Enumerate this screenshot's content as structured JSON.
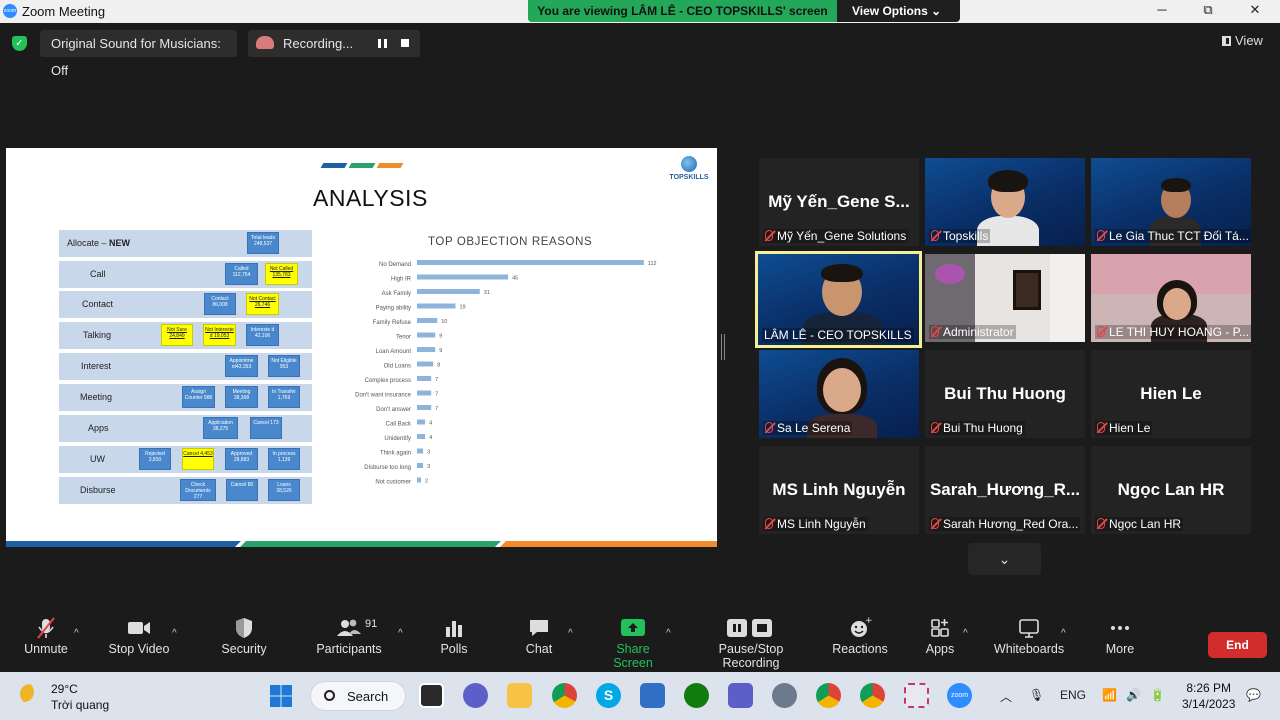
{
  "titlebar": {
    "title": "Zoom Meeting",
    "minimize": "─",
    "maximize": "⧉",
    "close": "✕"
  },
  "banner": {
    "text": "You are viewing LÂM LÊ - CEO TOPSKILLS' screen",
    "view_options": "View Options ⌄"
  },
  "topbar": {
    "original_sound": "Original Sound for Musicians: Off",
    "recording": "Recording...",
    "view": "View"
  },
  "slide": {
    "title": "ANALYSIS",
    "logo_text": "TOPSKILLS",
    "funnel_rows": [
      {
        "label": "Allocate – NEW",
        "bold": "NEW"
      },
      {
        "label": "Call"
      },
      {
        "label": "Contact"
      },
      {
        "label": "Talking"
      },
      {
        "label": "Interest"
      },
      {
        "label": "Meeting"
      },
      {
        "label": "Apps"
      },
      {
        "label": "UW"
      },
      {
        "label": "Disburse"
      }
    ],
    "funnel_boxes": {
      "total": "Total leads 248,537",
      "called": "Called 112,754",
      "not_called": "Not Called 135,783",
      "contact": "Contact 86,008",
      "not_contact": "Not Contact 26,746",
      "not_sure": "Not Sure 24,849",
      "not_interested": "Not Intereste d 19,053",
      "interested": "Intereste d 42,106",
      "appointment": "Appointme nt43,353",
      "not_eligible": "Not Eligible 953",
      "assign_counter": "Assign Counter 986",
      "meeting": "Meeting 38,368",
      "in_transfer": "In Transfer 1,769",
      "application": "Application 38,275",
      "cancel_apps": "Cancel 173",
      "rejected": "Rejected 3,830",
      "cancel_uw": "Cancel 4,453",
      "approved": "Approved 28,883",
      "in_process": "In process 1,139",
      "check_documents": "Check Documents 277",
      "cancel_disb": "Cancel 80",
      "loans": "Loans 28,526"
    }
  },
  "chart_data": {
    "type": "bar",
    "orientation": "horizontal",
    "title": "TOP OBJECTION REASONS",
    "categories": [
      "No Demand",
      "High IR",
      "Ask Family",
      "Paying ability",
      "Family Refuse",
      "Tenor",
      "Loan Amount",
      "Old Loans",
      "Complex process",
      "Don't want insurance",
      "Don't answer",
      "Call Back",
      "Unidentify",
      "Think again",
      "Disburse too long",
      "Not customer"
    ],
    "values": [
      112,
      45,
      31,
      19,
      10,
      9,
      9,
      8,
      7,
      7,
      7,
      4,
      4,
      3,
      3,
      2
    ],
    "xticks": [
      0,
      20,
      40,
      60,
      80,
      100,
      120
    ],
    "xlim": [
      0,
      120
    ],
    "color": "#8fb4dc"
  },
  "tiles": [
    {
      "big": "Mỹ Yến_Gene S...",
      "name": "Mỹ Yến_Gene Solutions"
    },
    {
      "big": "",
      "name": "Topskills"
    },
    {
      "big": "",
      "name": "Le Gia Thuc TCT Đối Tá..."
    },
    {
      "big": "",
      "name": "LÂM LÊ - CEO TOPSKILLS"
    },
    {
      "big": "",
      "name": "Administrator"
    },
    {
      "big": "",
      "name": "LE THI HUY HOANG - P..."
    },
    {
      "big": "",
      "name": "Sa Le Serena"
    },
    {
      "big": "Bui Thu Huong",
      "name": "Bui Thu Huong"
    },
    {
      "big": "Hien Le",
      "name": "Hien Le"
    },
    {
      "big": "MS Linh Nguyễn",
      "name": "MS Linh Nguyễn"
    },
    {
      "big": "Sarah_Hương_R...",
      "name": "Sarah Hương_Red Ora..."
    },
    {
      "big": "Ngọc Lan HR",
      "name": "Ngọc Lan HR"
    }
  ],
  "toolbar": {
    "unmute": "Unmute",
    "stop_video": "Stop Video",
    "security": "Security",
    "participants": "Participants",
    "participants_count": "91",
    "polls": "Polls",
    "chat": "Chat",
    "share_screen": "Share Screen",
    "pause_stop_recording": "Pause/Stop Recording",
    "reactions": "Reactions",
    "apps": "Apps",
    "whiteboards": "Whiteboards",
    "more": "More",
    "end": "End"
  },
  "taskbar": {
    "temp": "29°C",
    "weather": "Trời quang",
    "search": "Search",
    "lang": "ENG",
    "time": "8:26 PM",
    "date": "3/14/2023"
  },
  "colors": {
    "accent_green": "#23c15a",
    "end_red": "#d12d2d",
    "zoom_blue": "#2d8cff",
    "active_speaker": "#f4f094"
  }
}
